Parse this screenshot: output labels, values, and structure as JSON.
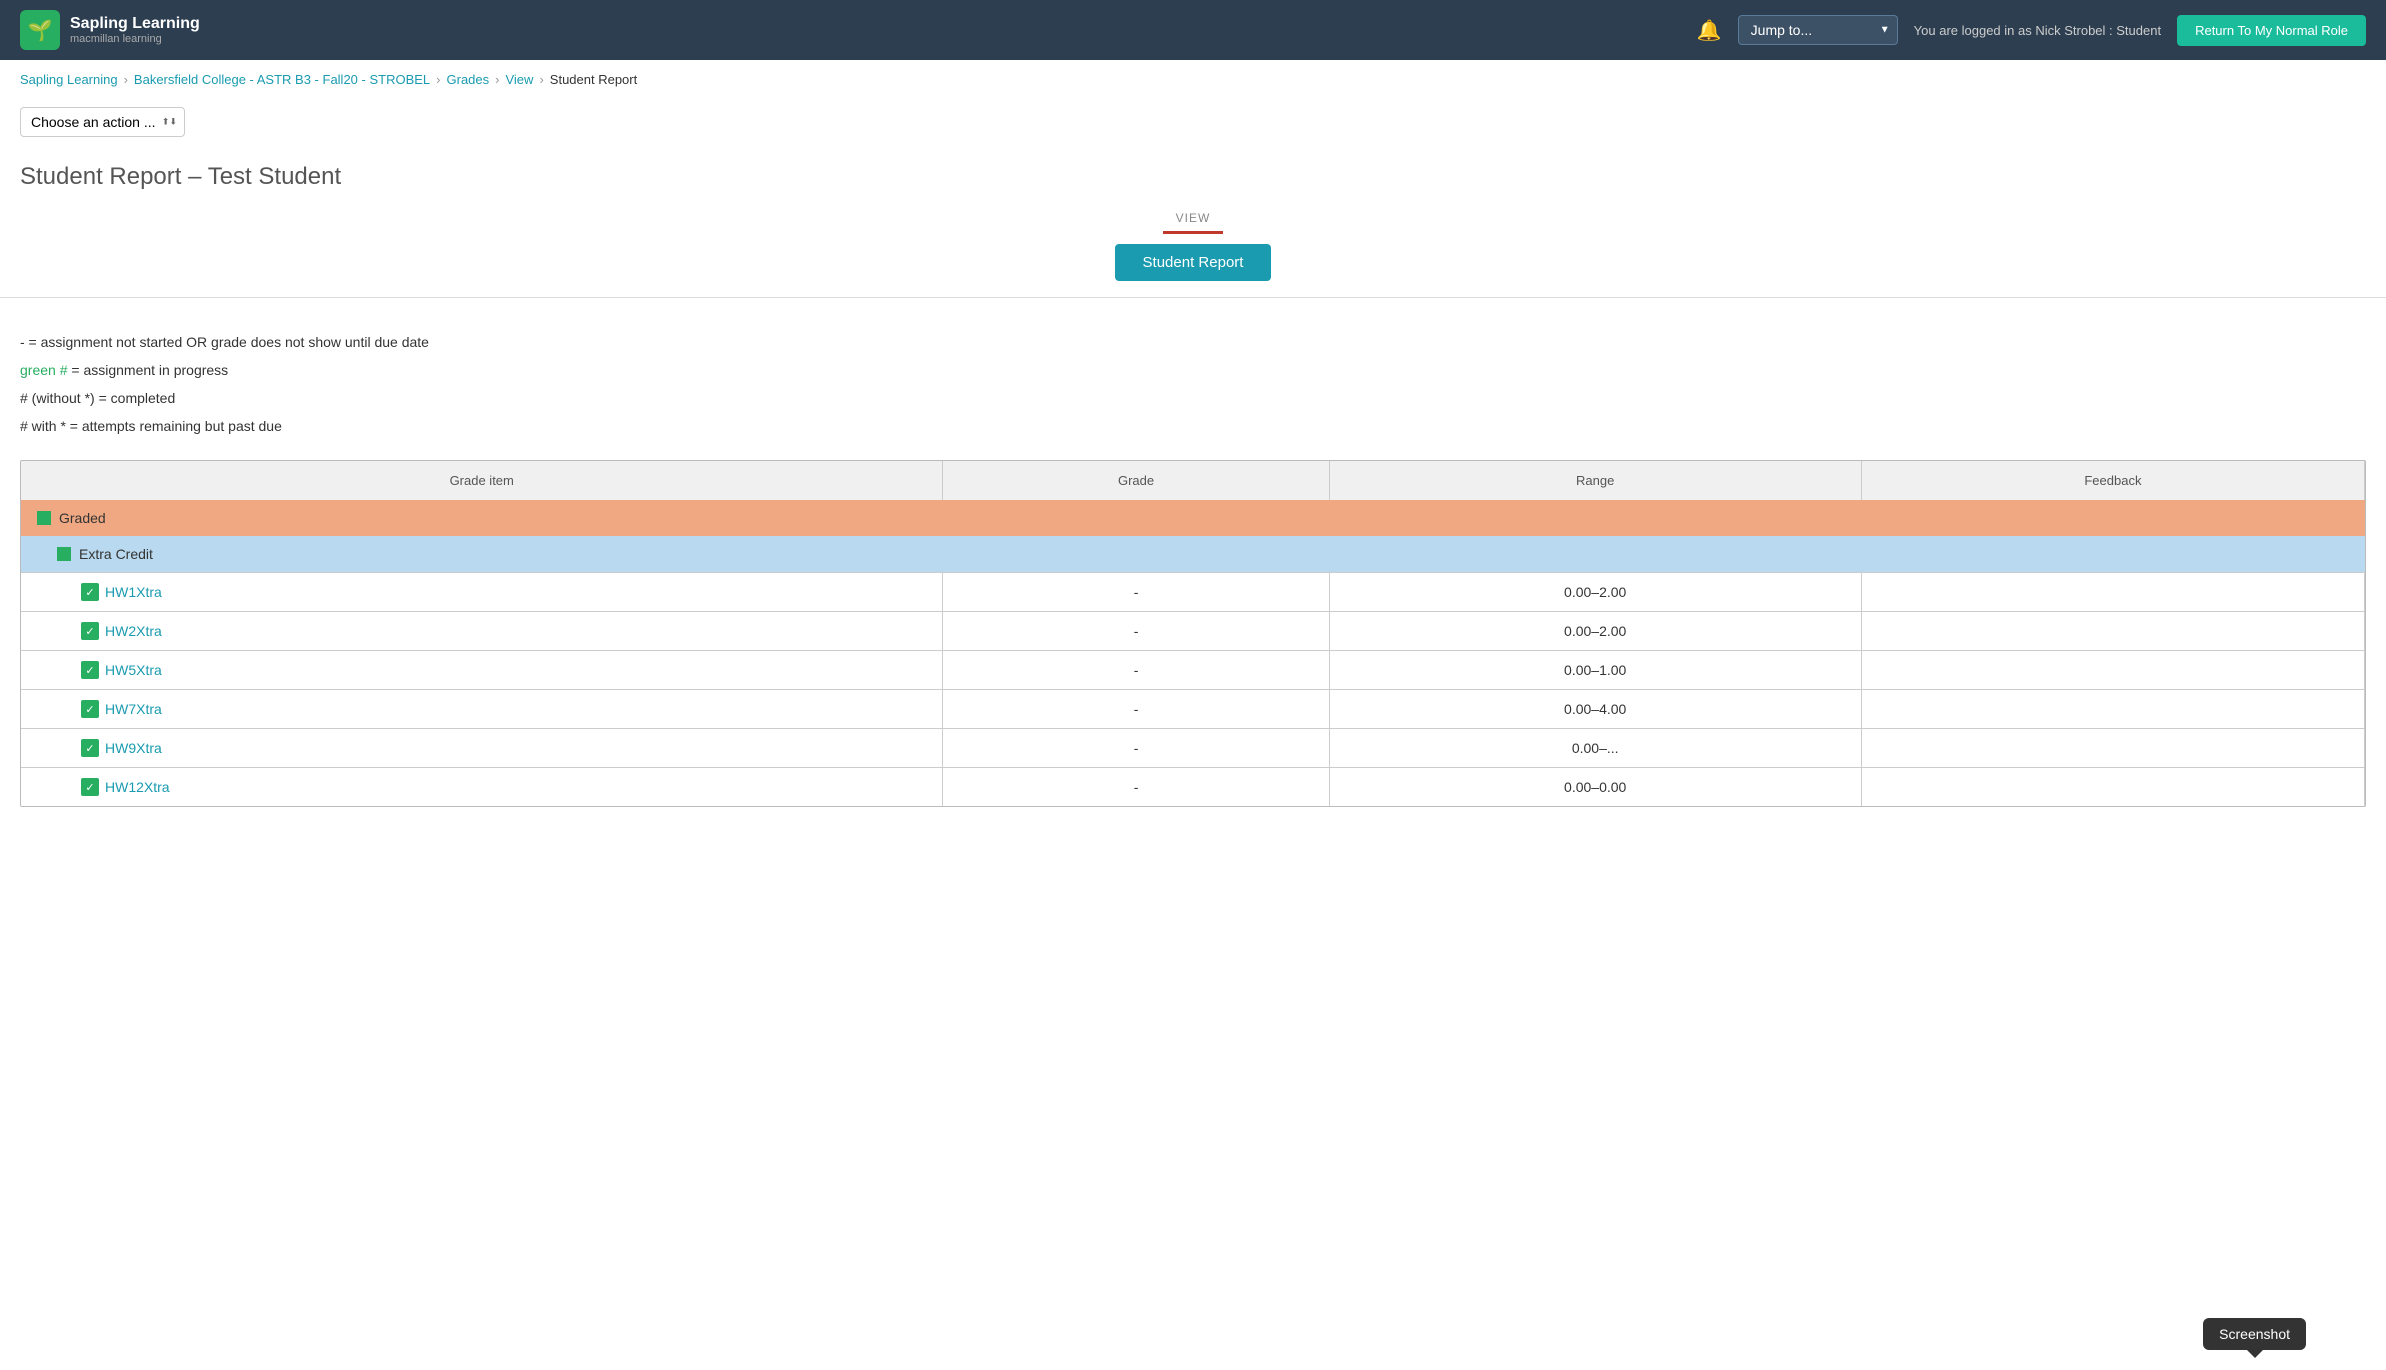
{
  "header": {
    "logo_main": "Sapling Learning",
    "logo_sub": "macmillan learning",
    "jump_label": "Jump to...",
    "logged_in_text": "You are logged in as Nick Strobel : Student",
    "return_btn": "Return To My Normal Role"
  },
  "breadcrumb": {
    "items": [
      "Sapling Learning",
      "Bakersfield College - ASTR B3 - Fall20 - STROBEL",
      "Grades",
      "View",
      "Student Report"
    ]
  },
  "action": {
    "label": "Choose an action ..."
  },
  "page": {
    "title_main": "Student Report",
    "title_sep": "–",
    "title_student": "Test Student"
  },
  "view_section": {
    "label": "VIEW",
    "tab_label": "Student Report"
  },
  "legend": {
    "line1": "- = assignment not started OR grade does not show until due date",
    "line2_prefix": "green #",
    "line2_suffix": " = assignment in progress",
    "line3": "# (without *) = completed",
    "line4": "# with * = attempts remaining but past due"
  },
  "table": {
    "headers": [
      "Grade item",
      "Grade",
      "Range",
      "Feedback"
    ],
    "categories": [
      {
        "name": "Graded",
        "subcategories": [
          {
            "name": "Extra Credit",
            "items": [
              {
                "name": "HW1Xtra",
                "grade": "-",
                "range": "0.00–2.00",
                "feedback": ""
              },
              {
                "name": "HW2Xtra",
                "grade": "-",
                "range": "0.00–2.00",
                "feedback": ""
              },
              {
                "name": "HW5Xtra",
                "grade": "-",
                "range": "0.00–1.00",
                "feedback": ""
              },
              {
                "name": "HW7Xtra",
                "grade": "-",
                "range": "0.00–4.00",
                "feedback": ""
              },
              {
                "name": "HW9Xtra",
                "grade": "-",
                "range": "0.00–...",
                "feedback": ""
              },
              {
                "name": "HW12Xtra",
                "grade": "-",
                "range": "0.00–0.00",
                "feedback": ""
              }
            ]
          }
        ]
      }
    ]
  },
  "tooltip": {
    "label": "Screenshot"
  }
}
